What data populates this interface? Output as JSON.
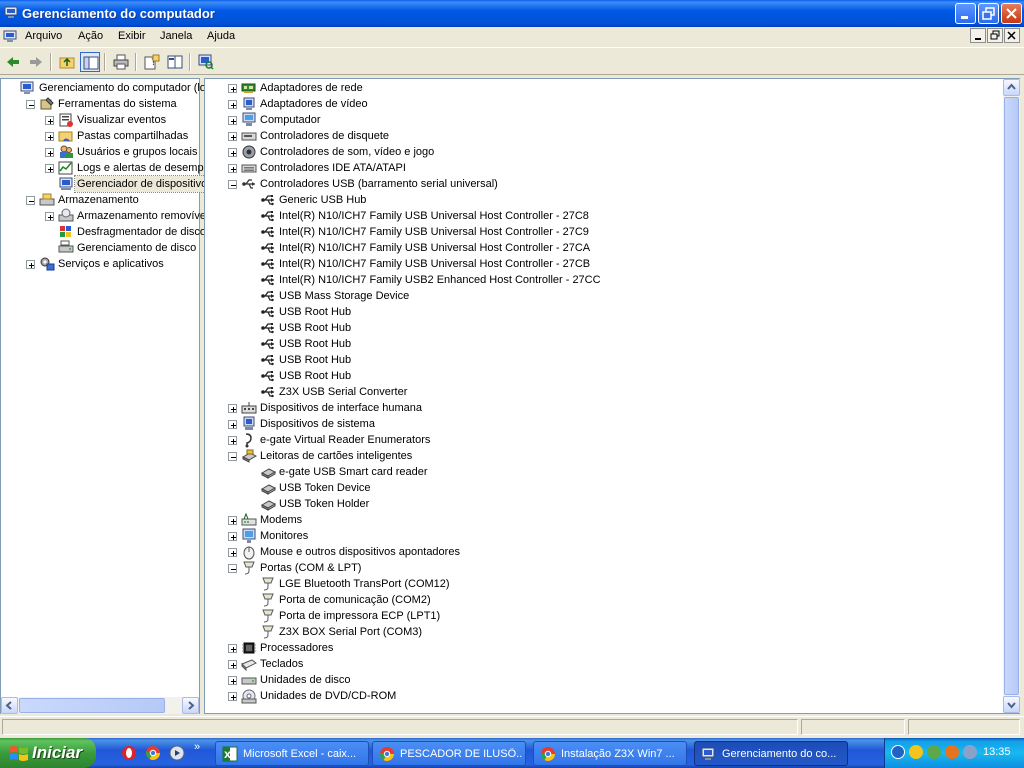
{
  "window": {
    "title": "Gerenciamento do computador"
  },
  "menu": [
    "Arquivo",
    "Ação",
    "Exibir",
    "Janela",
    "Ajuda"
  ],
  "left_tree": [
    {
      "label": "Gerenciamento do computador (loca",
      "icon": "computer-management-icon",
      "level": 0,
      "expander": "none"
    },
    {
      "label": "Ferramentas do sistema",
      "icon": "system-tools-icon",
      "level": 1,
      "expander": "minus"
    },
    {
      "label": "Visualizar eventos",
      "icon": "event-viewer-icon",
      "level": 2,
      "expander": "plus"
    },
    {
      "label": "Pastas compartilhadas",
      "icon": "shared-folders-icon",
      "level": 2,
      "expander": "plus"
    },
    {
      "label": "Usuários e grupos locais",
      "icon": "users-groups-icon",
      "level": 2,
      "expander": "plus"
    },
    {
      "label": "Logs e alertas de desempen",
      "icon": "performance-logs-icon",
      "level": 2,
      "expander": "plus"
    },
    {
      "label": "Gerenciador de dispositivos",
      "icon": "device-manager-icon",
      "level": 2,
      "expander": "none",
      "selected": true
    },
    {
      "label": "Armazenamento",
      "icon": "storage-icon",
      "level": 1,
      "expander": "minus"
    },
    {
      "label": "Armazenamento removível",
      "icon": "removable-storage-icon",
      "level": 2,
      "expander": "plus"
    },
    {
      "label": "Desfragmentador de disco",
      "icon": "defragmenter-icon",
      "level": 2,
      "expander": "none"
    },
    {
      "label": "Gerenciamento de disco",
      "icon": "disk-management-icon",
      "level": 2,
      "expander": "none"
    },
    {
      "label": "Serviços e aplicativos",
      "icon": "services-apps-icon",
      "level": 1,
      "expander": "plus"
    }
  ],
  "device_tree": [
    {
      "label": "Adaptadores de rede",
      "icon": "network-adapter-icon",
      "level": 0,
      "expander": "plus"
    },
    {
      "label": "Adaptadores de vídeo",
      "icon": "display-adapter-icon",
      "level": 0,
      "expander": "plus"
    },
    {
      "label": "Computador",
      "icon": "computer-icon",
      "level": 0,
      "expander": "plus"
    },
    {
      "label": "Controladores de disquete",
      "icon": "floppy-controller-icon",
      "level": 0,
      "expander": "plus"
    },
    {
      "label": "Controladores de som, vídeo e jogo",
      "icon": "sound-controller-icon",
      "level": 0,
      "expander": "plus"
    },
    {
      "label": "Controladores IDE ATA/ATAPI",
      "icon": "ide-controller-icon",
      "level": 0,
      "expander": "plus"
    },
    {
      "label": "Controladores USB (barramento serial universal)",
      "icon": "usb-controller-icon",
      "level": 0,
      "expander": "minus"
    },
    {
      "label": "Generic USB Hub",
      "icon": "usb-icon",
      "level": 1,
      "expander": "none"
    },
    {
      "label": "Intel(R) N10/ICH7 Family USB Universal Host Controller - 27C8",
      "icon": "usb-icon",
      "level": 1,
      "expander": "none"
    },
    {
      "label": "Intel(R) N10/ICH7 Family USB Universal Host Controller - 27C9",
      "icon": "usb-icon",
      "level": 1,
      "expander": "none"
    },
    {
      "label": "Intel(R) N10/ICH7 Family USB Universal Host Controller - 27CA",
      "icon": "usb-icon",
      "level": 1,
      "expander": "none"
    },
    {
      "label": "Intel(R) N10/ICH7 Family USB Universal Host Controller - 27CB",
      "icon": "usb-icon",
      "level": 1,
      "expander": "none"
    },
    {
      "label": "Intel(R) N10/ICH7 Family USB2 Enhanced Host Controller - 27CC",
      "icon": "usb-icon",
      "level": 1,
      "expander": "none"
    },
    {
      "label": "USB Mass Storage Device",
      "icon": "usb-icon",
      "level": 1,
      "expander": "none"
    },
    {
      "label": "USB Root Hub",
      "icon": "usb-icon",
      "level": 1,
      "expander": "none"
    },
    {
      "label": "USB Root Hub",
      "icon": "usb-icon",
      "level": 1,
      "expander": "none"
    },
    {
      "label": "USB Root Hub",
      "icon": "usb-icon",
      "level": 1,
      "expander": "none"
    },
    {
      "label": "USB Root Hub",
      "icon": "usb-icon",
      "level": 1,
      "expander": "none"
    },
    {
      "label": "USB Root Hub",
      "icon": "usb-icon",
      "level": 1,
      "expander": "none"
    },
    {
      "label": "Z3X USB Serial Converter",
      "icon": "usb-icon",
      "level": 1,
      "expander": "none"
    },
    {
      "label": "Dispositivos de interface humana",
      "icon": "hid-icon",
      "level": 0,
      "expander": "plus"
    },
    {
      "label": "Dispositivos de sistema",
      "icon": "system-device-icon",
      "level": 0,
      "expander": "plus"
    },
    {
      "label": "e-gate Virtual Reader Enumerators",
      "icon": "reader-enumerator-icon",
      "level": 0,
      "expander": "plus"
    },
    {
      "label": "Leitoras de cartões inteligentes",
      "icon": "smart-card-reader-icon",
      "level": 0,
      "expander": "minus"
    },
    {
      "label": "e-gate USB Smart card reader",
      "icon": "smart-card-icon",
      "level": 1,
      "expander": "none"
    },
    {
      "label": "USB Token Device",
      "icon": "smart-card-icon",
      "level": 1,
      "expander": "none"
    },
    {
      "label": "USB Token Holder",
      "icon": "smart-card-icon",
      "level": 1,
      "expander": "none"
    },
    {
      "label": "Modems",
      "icon": "modem-icon",
      "level": 0,
      "expander": "plus"
    },
    {
      "label": "Monitores",
      "icon": "monitor-icon",
      "level": 0,
      "expander": "plus"
    },
    {
      "label": "Mouse e outros dispositivos apontadores",
      "icon": "mouse-icon",
      "level": 0,
      "expander": "plus"
    },
    {
      "label": "Portas (COM & LPT)",
      "icon": "ports-icon",
      "level": 0,
      "expander": "minus"
    },
    {
      "label": "LGE Bluetooth TransPort (COM12)",
      "icon": "port-icon",
      "level": 1,
      "expander": "none"
    },
    {
      "label": "Porta de comunicação (COM2)",
      "icon": "port-icon",
      "level": 1,
      "expander": "none"
    },
    {
      "label": "Porta de impressora ECP (LPT1)",
      "icon": "port-icon",
      "level": 1,
      "expander": "none"
    },
    {
      "label": "Z3X BOX Serial Port (COM3)",
      "icon": "port-icon",
      "level": 1,
      "expander": "none"
    },
    {
      "label": "Processadores",
      "icon": "processor-icon",
      "level": 0,
      "expander": "plus"
    },
    {
      "label": "Teclados",
      "icon": "keyboard-icon",
      "level": 0,
      "expander": "plus"
    },
    {
      "label": "Unidades de disco",
      "icon": "disk-drive-icon",
      "level": 0,
      "expander": "plus"
    },
    {
      "label": "Unidades de DVD/CD-ROM",
      "icon": "dvd-drive-icon",
      "level": 0,
      "expander": "plus"
    }
  ],
  "taskbar": {
    "start_label": "Iniciar",
    "tasks": [
      {
        "label": "Microsoft Excel - caix...",
        "icon": "excel-icon",
        "active": false
      },
      {
        "label": "PESCADOR DE ILUSÕ...",
        "icon": "chrome-icon",
        "active": false
      },
      {
        "label": "Instalação Z3X Win7 ...",
        "icon": "chrome-icon",
        "active": false
      },
      {
        "label": "Gerenciamento do co...",
        "icon": "computer-management-icon",
        "active": true
      }
    ],
    "clock": "13:35",
    "overflow_glyph": "»"
  },
  "colors": {
    "selection": "#ece9d8",
    "pane_border": "#7f9db9",
    "title_blue": "#0054e3",
    "start_green": "#3c9a3c"
  }
}
